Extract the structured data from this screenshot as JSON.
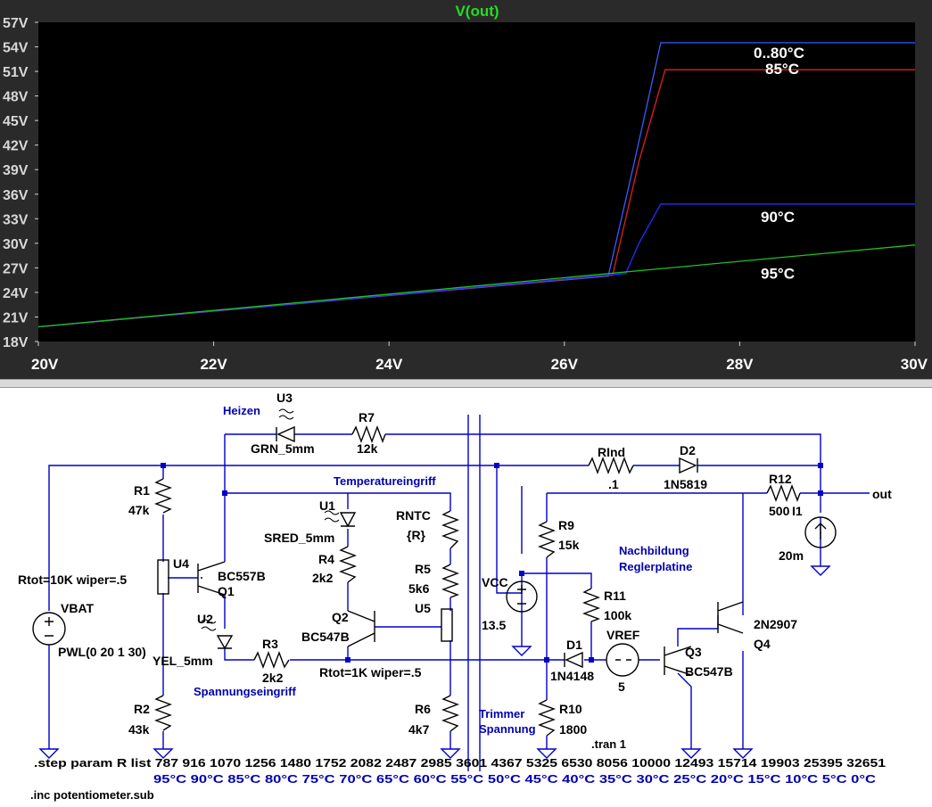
{
  "plot": {
    "trace_name": "V(out)",
    "background": "#000000",
    "frame_color": "#2a2a2a",
    "y_ticks": [
      "57V",
      "54V",
      "51V",
      "48V",
      "45V",
      "42V",
      "39V",
      "36V",
      "33V",
      "30V",
      "27V",
      "24V",
      "21V",
      "18V"
    ],
    "x_ticks": [
      "20V",
      "22V",
      "24V",
      "26V",
      "28V",
      "30V"
    ],
    "trace_labels": [
      {
        "text": "0..80°C",
        "level_v": 54.5
      },
      {
        "text": "85°C",
        "level_v": 51.2
      },
      {
        "text": "90°C",
        "level_v": 34.8
      },
      {
        "text": "95°C",
        "level_v": 27.0
      }
    ]
  },
  "chart_data": {
    "type": "line",
    "title": "V(out)",
    "xlim": [
      20,
      30
    ],
    "ylim": [
      18,
      57
    ],
    "grid": false,
    "series": [
      {
        "name": "0..80°C",
        "color": "#3b5bff",
        "x": [
          20,
          26.5,
          26.8,
          27.1,
          30
        ],
        "y": [
          19.8,
          26.0,
          40.0,
          54.5,
          54.5
        ]
      },
      {
        "name": "85°C",
        "color": "#e02020",
        "x": [
          20,
          26.55,
          26.85,
          27.15,
          30
        ],
        "y": [
          19.8,
          26.1,
          40.0,
          51.2,
          51.2
        ]
      },
      {
        "name": "90°C",
        "color": "#2030ff",
        "x": [
          20,
          26.7,
          26.85,
          27.1,
          30
        ],
        "y": [
          19.8,
          26.3,
          30.0,
          34.8,
          34.8
        ]
      },
      {
        "name": "95°C",
        "color": "#20c020",
        "x": [
          20,
          30
        ],
        "y": [
          19.8,
          29.8
        ]
      }
    ]
  },
  "schematic": {
    "notes": {
      "heizen": "Heizen",
      "temperatureingriff": "Temperatureingriff",
      "nachbildung": "Nachbildung",
      "reglerplatine": "Reglerplatine",
      "spannungseingriff": "Spannungseingriff",
      "trimmer": "Trimmer",
      "spannung": "Spannung"
    },
    "labels": {
      "u3": "U3",
      "grn": "GRN_5mm",
      "r7": "R7",
      "r7v": "12k",
      "rind": "RInd",
      "rindv": ".1",
      "d2": "D2",
      "d2v": "1N5819",
      "r12": "R12",
      "r12v": "500",
      "out": "out",
      "i1": "I1",
      "i1v": "20m",
      "r1": "R1",
      "r1v": "47k",
      "u4": "U4",
      "rtot10k": "Rtot=10K wiper=.5",
      "bc557": "BC557B",
      "q1": "Q1",
      "u1": "U1",
      "sred": "SRED_5mm",
      "r4": "R4",
      "r4v": "2k2",
      "rntc": "RNTC",
      "rntcv": "{R}",
      "r5": "R5",
      "r5v": "5k6",
      "u5": "U5",
      "q2": "Q2",
      "bc547a": "BC547B",
      "r9": "R9",
      "r9v": "15k",
      "vcc": "VCC",
      "vccv": "13.5",
      "r11": "R11",
      "r11v": "100k",
      "vbat": "VBAT",
      "pwl": "PWL(0 20 1 30)",
      "u2": "U2",
      "yel": "YEL_5mm",
      "r3": "R3",
      "r3v": "2k2",
      "rtot1k": "Rtot=1K wiper=.5",
      "d1": "D1",
      "d1v": "1N4148",
      "vref": "VREF",
      "vrefv": "5",
      "q3": "Q3",
      "bc547b": "BC547B",
      "q4": "Q4",
      "n2907": "2N2907",
      "r2": "R2",
      "r2v": "43k",
      "r6": "R6",
      "r6v": "4k7",
      "r10": "R10",
      "r10v": "1800"
    },
    "directives": {
      "tran": ".tran 1",
      "step": ".step param R list 787 916 1070 1256 1480 1752 2082 2487 2985 3601 4367 5325 6530 8056 10000 12493 15714 19903 25395 32651",
      "temps": "95°C 90°C 85°C 80°C 75°C 70°C 65°C 60°C 55°C 50°C 45°C 40°C 35°C  30°C  25°C  20°C  15°C  10°C  5°C  0°C",
      "inc": ".inc potentiometer.sub"
    }
  }
}
